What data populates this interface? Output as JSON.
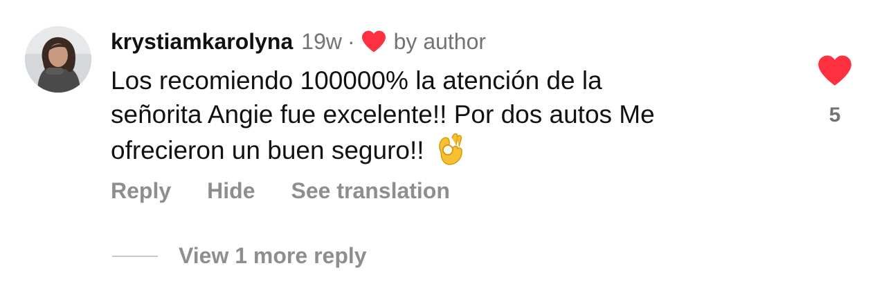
{
  "comment": {
    "username": "krystiamkarolyna",
    "time": "19w",
    "separator": "·",
    "author_badge": "by author",
    "text_lines": [
      "Los recomiendo 100000% la atención de la",
      "señorita Angie fue excelente!! Por dos autos Me",
      "ofrecieron un buen seguro!!"
    ],
    "emoji": "ok-hand-emoji",
    "like_count": "5"
  },
  "actions": {
    "reply": "Reply",
    "hide": "Hide",
    "see_translation": "See translation"
  },
  "replies": {
    "view_more": "View 1 more reply"
  },
  "colors": {
    "like_red": "#ff3040",
    "muted_text": "#737373",
    "action_text": "#8e8e8e"
  }
}
